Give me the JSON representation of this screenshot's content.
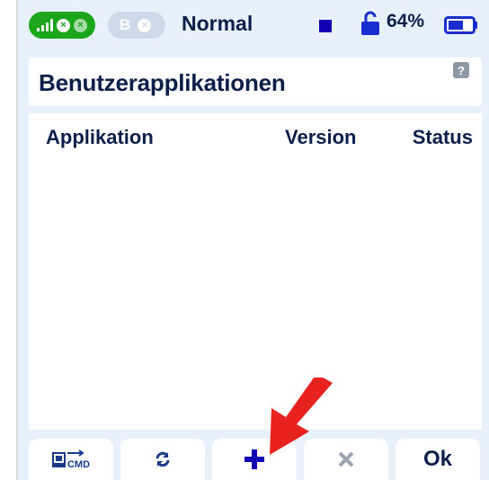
{
  "status": {
    "pill_a": {
      "icon": "signal-bars-icon",
      "indicators": [
        "close-circle-icon",
        "close-circle-icon"
      ]
    },
    "pill_b": {
      "letter": "B",
      "indicator": "close-circle-icon"
    },
    "mode": "Normal",
    "battery_percent": "64%",
    "battery_level": 0.64,
    "colors": {
      "green": "#1ca61c",
      "blue": "#1200b4",
      "text": "#0c1f4a"
    }
  },
  "title_bar": {
    "title": "Benutzerapplikationen",
    "help_label": "?"
  },
  "table": {
    "columns": [
      "Applikation",
      "Version",
      "Status"
    ],
    "rows": []
  },
  "buttons": {
    "cmd_label": "CMD",
    "ok_label": "Ok",
    "icons": [
      "terminal-cmd-icon",
      "refresh-icon",
      "plus-icon",
      "close-icon"
    ]
  },
  "annotation": {
    "icon": "red-arrow-icon",
    "color": "#e8231f"
  }
}
